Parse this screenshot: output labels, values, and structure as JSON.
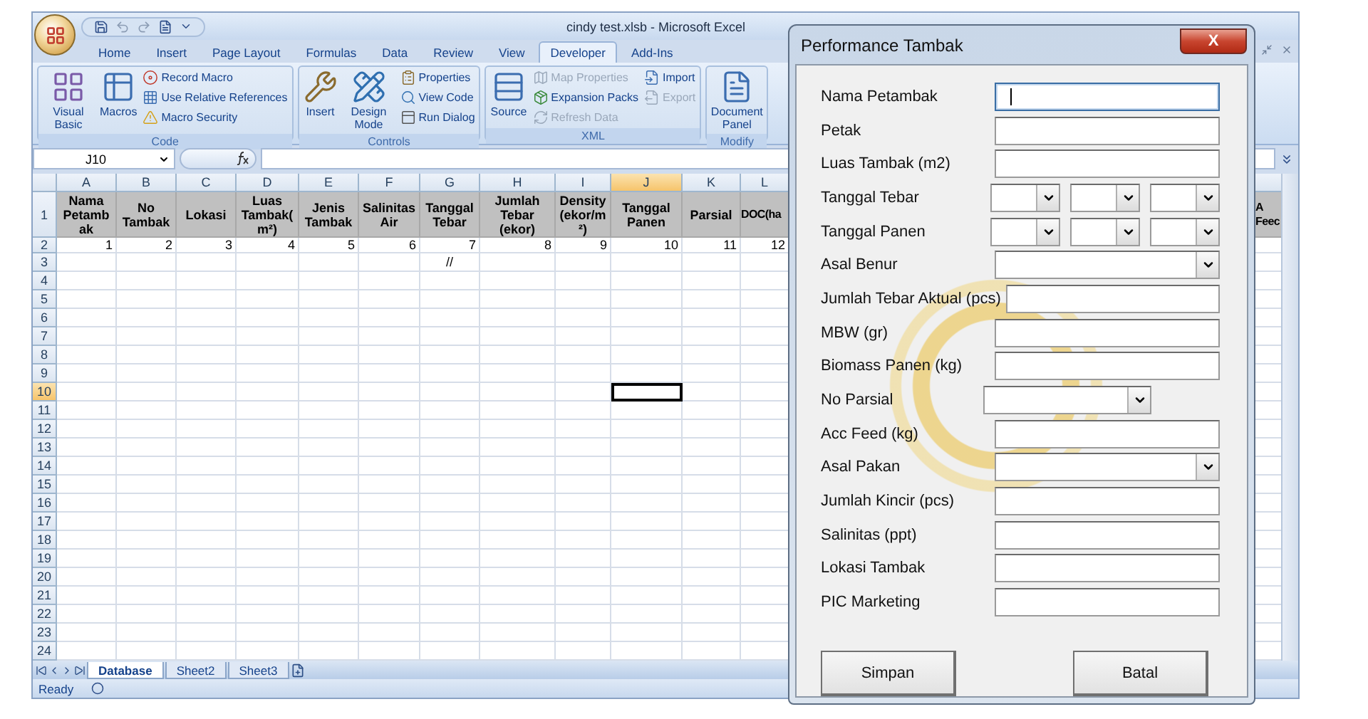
{
  "window": {
    "title": "cindy test.xlsb - Microsoft Excel"
  },
  "ribbon": {
    "tabs": [
      {
        "label": "Home",
        "selected": false
      },
      {
        "label": "Insert",
        "selected": false
      },
      {
        "label": "Page Layout",
        "selected": false
      },
      {
        "label": "Formulas",
        "selected": false
      },
      {
        "label": "Data",
        "selected": false
      },
      {
        "label": "Review",
        "selected": false
      },
      {
        "label": "View",
        "selected": false
      },
      {
        "label": "Developer",
        "selected": true
      },
      {
        "label": "Add-Ins",
        "selected": false
      }
    ],
    "groups": [
      {
        "label": "Code",
        "buttons": [
          {
            "label": "Visual Basic",
            "kind": "large",
            "disabled": false
          },
          {
            "label": "Macros",
            "kind": "large",
            "disabled": false
          },
          {
            "label": "Record Macro",
            "kind": "small",
            "disabled": false
          },
          {
            "label": "Use Relative References",
            "kind": "small",
            "disabled": false
          },
          {
            "label": "Macro Security",
            "kind": "small",
            "disabled": false
          }
        ]
      },
      {
        "label": "Controls",
        "buttons": [
          {
            "label": "Insert",
            "kind": "large",
            "disabled": false
          },
          {
            "label": "Design Mode",
            "kind": "large",
            "disabled": false
          },
          {
            "label": "Properties",
            "kind": "small",
            "disabled": false
          },
          {
            "label": "View Code",
            "kind": "small",
            "disabled": false
          },
          {
            "label": "Run Dialog",
            "kind": "small",
            "disabled": false
          }
        ]
      },
      {
        "label": "XML",
        "buttons": [
          {
            "label": "Source",
            "kind": "large",
            "disabled": false
          },
          {
            "label": "Map Properties",
            "kind": "small",
            "disabled": true
          },
          {
            "label": "Expansion Packs",
            "kind": "small",
            "disabled": false
          },
          {
            "label": "Refresh Data",
            "kind": "small",
            "disabled": true
          },
          {
            "label": "Import",
            "kind": "small",
            "disabled": false
          },
          {
            "label": "Export",
            "kind": "small",
            "disabled": true
          }
        ]
      },
      {
        "label": "Modify",
        "buttons": [
          {
            "label": "Document Panel",
            "kind": "large",
            "disabled": false
          }
        ]
      }
    ]
  },
  "formula_bar": {
    "name_box": "J10"
  },
  "sheet": {
    "columns": [
      {
        "letter": "A",
        "header": "Nama Petambak",
        "selected": false,
        "cells": [
          "1"
        ]
      },
      {
        "letter": "B",
        "header": "No Tambak",
        "selected": false,
        "cells": [
          "2"
        ]
      },
      {
        "letter": "C",
        "header": "Lokasi",
        "selected": false,
        "cells": [
          "3"
        ]
      },
      {
        "letter": "D",
        "header": "Luas Tambak(m²)",
        "selected": false,
        "cells": [
          "4"
        ]
      },
      {
        "letter": "E",
        "header": "Jenis Tambak",
        "selected": false,
        "cells": [
          "5"
        ]
      },
      {
        "letter": "F",
        "header": "Salinitas Air",
        "selected": false,
        "cells": [
          "6"
        ]
      },
      {
        "letter": "G",
        "header": "Tanggal Tebar",
        "selected": false,
        "cells": [
          "7",
          "//"
        ]
      },
      {
        "letter": "H",
        "header": "Jumlah Tebar (ekor)",
        "selected": false,
        "cells": [
          "8"
        ]
      },
      {
        "letter": "I",
        "header": "Density(ekor/m²)",
        "selected": false,
        "cells": [
          "9"
        ]
      },
      {
        "letter": "J",
        "header": "Tanggal Panen",
        "selected": true,
        "cells": [
          "10"
        ]
      },
      {
        "letter": "K",
        "header": "Parsial",
        "selected": false,
        "cells": [
          "11"
        ]
      },
      {
        "letter": "L",
        "header": "DOC(ha",
        "selected": false,
        "cells": [
          "12"
        ]
      },
      {
        "header": "A Feec",
        "selected": false
      }
    ],
    "rows": [
      {
        "label": "1",
        "selected": false
      },
      {
        "label": "2",
        "selected": false
      },
      {
        "label": "3",
        "selected": false
      },
      {
        "label": "4",
        "selected": false
      },
      {
        "label": "5",
        "selected": false
      },
      {
        "label": "6",
        "selected": false
      },
      {
        "label": "7",
        "selected": false
      },
      {
        "label": "8",
        "selected": false
      },
      {
        "label": "9",
        "selected": false
      },
      {
        "label": "10",
        "selected": true
      },
      {
        "label": "11",
        "selected": false
      },
      {
        "label": "12",
        "selected": false
      },
      {
        "label": "13",
        "selected": false
      },
      {
        "label": "14",
        "selected": false
      },
      {
        "label": "15",
        "selected": false
      },
      {
        "label": "16",
        "selected": false
      },
      {
        "label": "17",
        "selected": false
      },
      {
        "label": "18",
        "selected": false
      },
      {
        "label": "19",
        "selected": false
      },
      {
        "label": "20",
        "selected": false
      },
      {
        "label": "21",
        "selected": false
      },
      {
        "label": "22",
        "selected": false
      },
      {
        "label": "23",
        "selected": false
      },
      {
        "label": "24",
        "selected": false
      }
    ],
    "tabs": [
      {
        "label": "Database",
        "selected": true
      },
      {
        "label": "Sheet2",
        "selected": false
      },
      {
        "label": "Sheet3",
        "selected": false
      }
    ]
  },
  "status_bar": {
    "text": "Ready"
  },
  "dialog": {
    "title": "Performance Tambak",
    "close": "X",
    "fields": [
      {
        "kind": "text",
        "label": "Nama Petambak",
        "focused": true
      },
      {
        "kind": "text",
        "label": "Petak",
        "focused": false
      },
      {
        "kind": "text",
        "label": "Luas Tambak (m2)",
        "focused": false
      },
      {
        "kind": "date",
        "label": "Tanggal Tebar"
      },
      {
        "kind": "date",
        "label": "Tanggal Panen"
      },
      {
        "kind": "combo",
        "label": "Asal Benur"
      },
      {
        "kind": "text",
        "label": "Jumlah Tebar Aktual (pcs)",
        "focused": false
      },
      {
        "kind": "text",
        "label": "MBW (gr)",
        "focused": false
      },
      {
        "kind": "text",
        "label": "Biomass Panen (kg)",
        "focused": false
      },
      {
        "kind": "short-combo",
        "label": "No Parsial"
      },
      {
        "kind": "text",
        "label": "Acc Feed (kg)",
        "focused": false
      },
      {
        "kind": "combo",
        "label": "Asal Pakan"
      },
      {
        "kind": "text",
        "label": "Jumlah Kincir (pcs)",
        "focused": false
      },
      {
        "kind": "text",
        "label": "Salinitas (ppt)",
        "focused": false
      },
      {
        "kind": "text",
        "label": "Lokasi Tambak",
        "focused": false
      },
      {
        "kind": "text",
        "label": "PIC Marketing",
        "focused": false
      }
    ],
    "buttons": [
      "Simpan",
      "Batal"
    ]
  }
}
